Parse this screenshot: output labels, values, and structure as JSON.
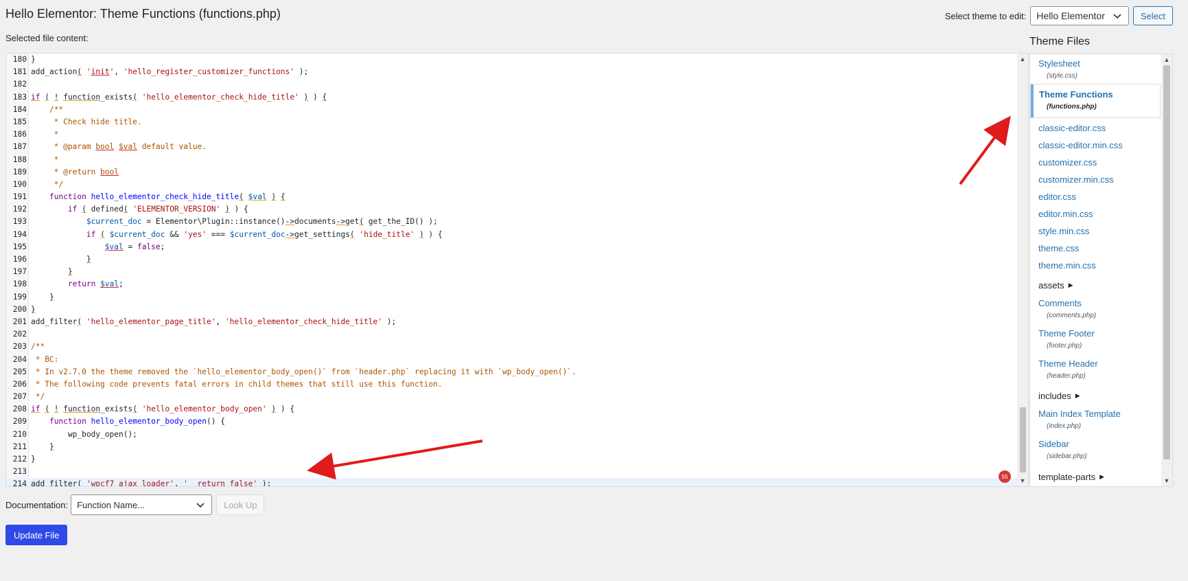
{
  "header": {
    "title": "Hello Elementor: Theme Functions (functions.php)",
    "selected_file_label": "Selected file content:",
    "select_theme_label": "Select theme to edit:",
    "theme_value": "Hello Elementor",
    "select_button": "Select"
  },
  "editor": {
    "lint_count": "55",
    "lines": [
      {
        "n": "180",
        "html": "}"
      },
      {
        "n": "181",
        "html": "add_action<span class=\"ul\">(</span> <span class=\"str\">'<span class=\"ul-red\">init</span>'</span>, <span class=\"str\">'hello_register_customizer_functions'</span> );"
      },
      {
        "n": "182",
        "html": ""
      },
      {
        "n": "183",
        "html": "<span class=\"kw ul\">if</span> <span class=\"ul\">(</span> <span class=\"ul\">!</span> <span class=\"ul\">function</span>_exists<span class=\"ul\">(</span> <span class=\"str\">'hello_elementor_check_hide_title'</span> <span class=\"ul\">)</span> ) <span class=\"ul\">{</span>"
      },
      {
        "n": "184",
        "html": "    <span class=\"com\">/**</span>"
      },
      {
        "n": "185",
        "html": "<span class=\"com\">     * Check hide title.</span>"
      },
      {
        "n": "186",
        "html": "<span class=\"com\">     *</span>"
      },
      {
        "n": "187",
        "html": "<span class=\"com\">     * @param <span class=\"ul-red\">bool</span> <span class=\"ul-red\">$val</span> default value.</span>"
      },
      {
        "n": "188",
        "html": "<span class=\"com\">     *</span>"
      },
      {
        "n": "189",
        "html": "<span class=\"com\">     * @return <span class=\"ul-red\">bool</span></span>"
      },
      {
        "n": "190",
        "html": "<span class=\"com\">     */</span>"
      },
      {
        "n": "191",
        "html": "    <span class=\"kw\">function</span> <span class=\"fn\">hello_elementor_check_hide_title</span><span class=\"ul\">(</span> <span class=\"var ul\">$val</span> <span class=\"ul\">)</span> <span class=\"ul\">{</span>"
      },
      {
        "n": "192",
        "html": "        <span class=\"kw\">if</span> <span class=\"ul\">(</span> defined<span class=\"ul\">(</span> <span class=\"str\">'ELEMENTOR_VERSION'</span> <span class=\"ul\">)</span> ) {"
      },
      {
        "n": "193",
        "html": "            <span class=\"var\">$current_doc</span> = Elementor\\Plugin::instance()<span class=\"ul\">-&gt;</span>documents<span class=\"ul\">-&gt;</span>get<span class=\"ul\">(</span> get_the_ID() );"
      },
      {
        "n": "194",
        "html": "            <span class=\"kw\">if</span> <span class=\"ul\">(</span> <span class=\"var\">$current_doc</span> &amp;&amp; <span class=\"str\">'yes'</span> === <span class=\"var\">$current_doc</span><span class=\"ul\">-&gt;</span>get_settings<span class=\"ul\">(</span> <span class=\"str\">'hide_title'</span> <span class=\"ul\">)</span> ) {"
      },
      {
        "n": "195",
        "html": "                <span class=\"var ul-red\">$val</span> = <span class=\"kw\">false</span>;"
      },
      {
        "n": "196",
        "html": "            <span class=\"ul\">}</span>"
      },
      {
        "n": "197",
        "html": "        <span class=\"ul\">}</span>"
      },
      {
        "n": "198",
        "html": "        <span class=\"kw\">return</span> <span class=\"var ul-red\">$val</span>;"
      },
      {
        "n": "199",
        "html": "    <span class=\"ul\">}</span>"
      },
      {
        "n": "200",
        "html": "<span class=\"ul\">}</span>"
      },
      {
        "n": "201",
        "html": "add_filter<span class=\"ul\">(</span> <span class=\"str\">'hello_elementor_page_title'</span>, <span class=\"str\">'hello_elementor_check_hide_title'</span> );"
      },
      {
        "n": "202",
        "html": ""
      },
      {
        "n": "203",
        "html": "<span class=\"com\">/**</span>"
      },
      {
        "n": "204",
        "html": "<span class=\"com\"> * BC:</span>"
      },
      {
        "n": "205",
        "html": "<span class=\"com\"> * In v2.7.0 the theme removed the `hello_elementor_body_open()` from `header.php` replacing it with `wp_body_open()`.</span>"
      },
      {
        "n": "206",
        "html": "<span class=\"com\"> * The following code prevents fatal errors in child themes that still use this function.</span>"
      },
      {
        "n": "207",
        "html": "<span class=\"com\"> */</span>"
      },
      {
        "n": "208",
        "html": "<span class=\"kw ul\">if</span> <span class=\"ul\">(</span> <span class=\"ul\">!</span> <span class=\"ul\">function</span>_exists<span class=\"ul\">(</span> <span class=\"str\">'hello_elementor_body_open'</span> <span class=\"ul\">)</span> ) {"
      },
      {
        "n": "209",
        "html": "    <span class=\"kw\">function</span> <span class=\"fn\">hello_elementor_body_open</span>() {"
      },
      {
        "n": "210",
        "html": "        wp_body_open();"
      },
      {
        "n": "211",
        "html": "    <span class=\"ul\">}</span>"
      },
      {
        "n": "212",
        "html": "}"
      },
      {
        "n": "213",
        "html": ""
      },
      {
        "n": "214",
        "html": "add_filter( <span class=\"str\">'wpcf7_ajax_loader'</span>, <span class=\"str\">'__return_false'</span> );"
      }
    ]
  },
  "sidebar": {
    "title": "Theme Files",
    "stylesheet": {
      "label": "Stylesheet",
      "sub": "(style.css)"
    },
    "active": {
      "label": "Theme Functions",
      "sub": "(functions.php)"
    },
    "files": [
      "classic-editor.css",
      "classic-editor.min.css",
      "customizer.css",
      "customizer.min.css",
      "editor.css",
      "editor.min.css",
      "style.min.css",
      "theme.css",
      "theme.min.css"
    ],
    "assets": "assets",
    "comments": {
      "label": "Comments",
      "sub": "(comments.php)"
    },
    "footer": {
      "label": "Theme Footer",
      "sub": "(footer.php)"
    },
    "header": {
      "label": "Theme Header",
      "sub": "(header.php)"
    },
    "includes": "includes",
    "index": {
      "label": "Main Index Template",
      "sub": "(index.php)"
    },
    "sidebar_tpl": {
      "label": "Sidebar",
      "sub": "(sidebar.php)"
    },
    "template_parts": "template-parts"
  },
  "footer": {
    "documentation_label": "Documentation:",
    "function_placeholder": "Function Name...",
    "lookup_button": "Look Up",
    "update_button": "Update File"
  }
}
